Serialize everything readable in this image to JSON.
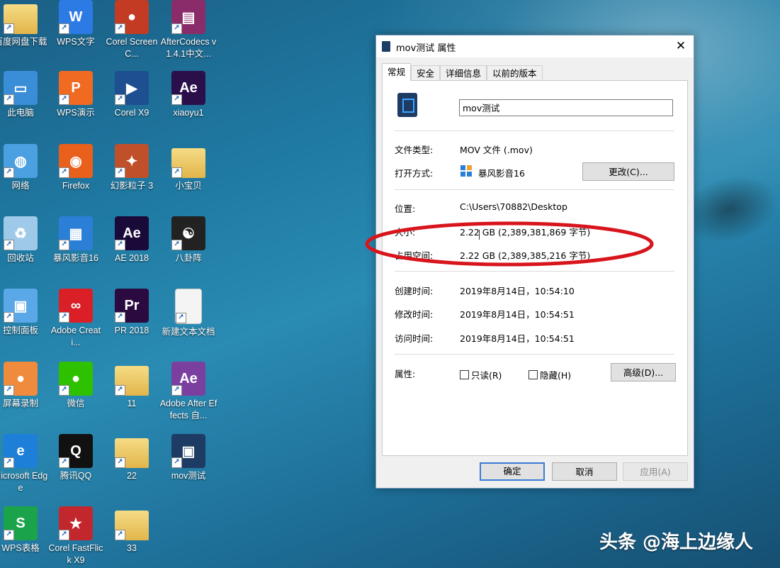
{
  "desktop": {
    "icons": [
      {
        "label": "百度网盘下载",
        "icon": "folder-icon",
        "col": 0,
        "row": 0,
        "color": "#e8c96a",
        "glyph": ""
      },
      {
        "label": "WPS文字",
        "icon": "wps-writer-icon",
        "col": 1,
        "row": 0,
        "color": "#2c7be5",
        "glyph": "W"
      },
      {
        "label": "Corel ScreenC...",
        "icon": "corel-screencap-icon",
        "col": 2,
        "row": 0,
        "color": "#c23b22",
        "glyph": "●"
      },
      {
        "label": "AfterCodecs v1.4.1中文...",
        "icon": "winrar-icon",
        "col": 3,
        "row": 0,
        "color": "#8b2c6a",
        "glyph": "▤"
      },
      {
        "label": "此电脑",
        "icon": "computer-icon",
        "col": 0,
        "row": 1,
        "color": "#3a8ed8",
        "glyph": "▭"
      },
      {
        "label": "WPS演示",
        "icon": "wps-presentation-icon",
        "col": 1,
        "row": 1,
        "color": "#f06a22",
        "glyph": "P"
      },
      {
        "label": "Corel X9",
        "icon": "corel-x9-icon",
        "col": 2,
        "row": 1,
        "color": "#1d4f91",
        "glyph": "▶"
      },
      {
        "label": "xiaoyu1",
        "icon": "aep-file-icon",
        "col": 3,
        "row": 1,
        "color": "#2a0f4a",
        "glyph": "Ae"
      },
      {
        "label": "网络",
        "icon": "network-icon",
        "col": 0,
        "row": 2,
        "color": "#4aa0e0",
        "glyph": "◍"
      },
      {
        "label": "Firefox",
        "icon": "firefox-icon",
        "col": 1,
        "row": 2,
        "color": "#e8601c",
        "glyph": "◉"
      },
      {
        "label": "幻影粒子 3",
        "icon": "particle-app-icon",
        "col": 2,
        "row": 2,
        "color": "#c0502a",
        "glyph": "✦"
      },
      {
        "label": "小宝贝",
        "icon": "folder-icon",
        "col": 3,
        "row": 2,
        "color": "#e8c96a",
        "glyph": ""
      },
      {
        "label": "回收站",
        "icon": "recycle-bin-icon",
        "col": 0,
        "row": 3,
        "color": "#9fc9e8",
        "glyph": "♻"
      },
      {
        "label": "暴风影音16",
        "icon": "storm-player-icon",
        "col": 1,
        "row": 3,
        "color": "#2b7fd6",
        "glyph": "▦"
      },
      {
        "label": "AE 2018",
        "icon": "after-effects-icon",
        "col": 2,
        "row": 3,
        "color": "#1a0a3a",
        "glyph": "Ae"
      },
      {
        "label": "八卦阵",
        "icon": "bagua-icon",
        "col": 3,
        "row": 3,
        "color": "#222222",
        "glyph": "☯"
      },
      {
        "label": "控制面板",
        "icon": "control-panel-icon",
        "col": 0,
        "row": 4,
        "color": "#5aa8e8",
        "glyph": "▣"
      },
      {
        "label": "Adobe Creati...",
        "icon": "creative-cloud-icon",
        "col": 1,
        "row": 4,
        "color": "#da1f26",
        "glyph": "∞"
      },
      {
        "label": "PR 2018",
        "icon": "premiere-icon",
        "col": 2,
        "row": 4,
        "color": "#2a0a3f",
        "glyph": "Pr"
      },
      {
        "label": "新建文本文档",
        "icon": "text-document-icon",
        "col": 3,
        "row": 4,
        "color": "#f4f4f4",
        "glyph": ""
      },
      {
        "label": "屏幕录制",
        "icon": "screen-recorder-icon",
        "col": 0,
        "row": 5,
        "color": "#f08a3c",
        "glyph": "●"
      },
      {
        "label": "微信",
        "icon": "wechat-icon",
        "col": 1,
        "row": 5,
        "color": "#2dc100",
        "glyph": "●"
      },
      {
        "label": "11",
        "icon": "folder-icon",
        "col": 2,
        "row": 5,
        "color": "#e8c96a",
        "glyph": ""
      },
      {
        "label": "Adobe After Effects 自...",
        "icon": "ae-archive-icon",
        "col": 3,
        "row": 5,
        "color": "#7b3fa0",
        "glyph": "Ae"
      },
      {
        "label": "Microsoft Edge",
        "icon": "edge-icon",
        "col": 0,
        "row": 6,
        "color": "#1e7fd8",
        "glyph": "e"
      },
      {
        "label": "腾讯QQ",
        "icon": "qq-icon",
        "col": 1,
        "row": 6,
        "color": "#111111",
        "glyph": "Q"
      },
      {
        "label": "22",
        "icon": "folder-icon",
        "col": 2,
        "row": 6,
        "color": "#e8c96a",
        "glyph": ""
      },
      {
        "label": "mov测试",
        "icon": "mov-file-icon",
        "col": 3,
        "row": 6,
        "color": "#1d3b63",
        "glyph": "▣"
      },
      {
        "label": "WPS表格",
        "icon": "wps-spreadsheet-icon",
        "col": 0,
        "row": 7,
        "color": "#1aa34a",
        "glyph": "S"
      },
      {
        "label": "Corel FastFlick X9",
        "icon": "corel-fastflick-icon",
        "col": 1,
        "row": 7,
        "color": "#c2272d",
        "glyph": "★"
      },
      {
        "label": "33",
        "icon": "folder-icon",
        "col": 2,
        "row": 7,
        "color": "#e8c96a",
        "glyph": ""
      }
    ]
  },
  "dialog": {
    "title": "mov测试 属性",
    "close": "✕",
    "tabs": [
      {
        "label": "常规",
        "active": true
      },
      {
        "label": "安全",
        "active": false
      },
      {
        "label": "详细信息",
        "active": false
      },
      {
        "label": "以前的版本",
        "active": false
      }
    ],
    "filename": "mov测试",
    "file_type_label": "文件类型:",
    "file_type_value": "MOV 文件 (.mov)",
    "open_with_label": "打开方式:",
    "open_with_value": "暴风影音16",
    "change_button": "更改(C)...",
    "location_label": "位置:",
    "location_value": "C:\\Users\\70882\\Desktop",
    "size_label": "大小:",
    "size_value": "2.22 GB (2,389,381,869 字节)",
    "disk_size_label": "占用空间:",
    "disk_size_value": "2.22 GB (2,389,385,216 字节)",
    "created_label": "创建时间:",
    "created_value": "2019年8月14日，10:54:10",
    "modified_label": "修改时间:",
    "modified_value": "2019年8月14日，10:54:51",
    "accessed_label": "访问时间:",
    "accessed_value": "2019年8月14日，10:54:51",
    "attributes_label": "属性:",
    "readonly_label": "只读(R)",
    "hidden_label": "隐藏(H)",
    "advanced_button": "高级(D)...",
    "ok_button": "确定",
    "cancel_button": "取消",
    "apply_button": "应用(A)"
  },
  "annotation": {
    "color": "#d8141c"
  },
  "watermark": "头条 @海上边缘人"
}
